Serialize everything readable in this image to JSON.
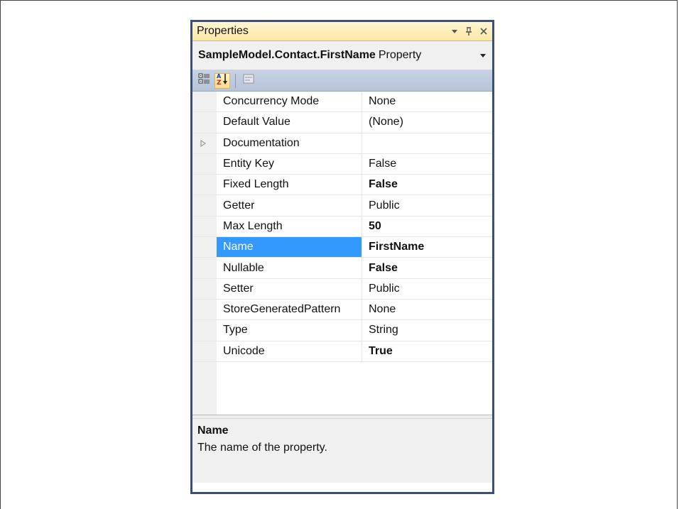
{
  "window": {
    "title": "Properties",
    "selected_object": "SampleModel.Contact.FirstName",
    "selected_object_type": "Property"
  },
  "toolbar": {
    "buttons": [
      {
        "icon": "categorized-icon",
        "active": false
      },
      {
        "icon": "alphabetical-icon",
        "active": true
      },
      {
        "icon": "property-pages-icon",
        "active": false,
        "disabled": true
      }
    ]
  },
  "properties": [
    {
      "name": "Concurrency Mode",
      "value": "None",
      "bold": false
    },
    {
      "name": "Default Value",
      "value": "(None)",
      "bold": false
    },
    {
      "name": "Documentation",
      "value": "",
      "bold": false,
      "expandable": true
    },
    {
      "name": "Entity Key",
      "value": "False",
      "bold": false
    },
    {
      "name": "Fixed Length",
      "value": "False",
      "bold": true
    },
    {
      "name": "Getter",
      "value": "Public",
      "bold": false
    },
    {
      "name": "Max Length",
      "value": "50",
      "bold": true
    },
    {
      "name": "Name",
      "value": "FirstName",
      "bold": true,
      "selected": true
    },
    {
      "name": "Nullable",
      "value": "False",
      "bold": true
    },
    {
      "name": "Setter",
      "value": "Public",
      "bold": false
    },
    {
      "name": "StoreGeneratedPattern",
      "value": "None",
      "bold": false
    },
    {
      "name": "Type",
      "value": "String",
      "bold": false
    },
    {
      "name": "Unicode",
      "value": "True",
      "bold": true
    }
  ],
  "description": {
    "title": "Name",
    "text": "The name of the property."
  },
  "colors": {
    "selection": "#3399ff",
    "titlebar": "#fde7a6",
    "toolbar": "#bcc7da",
    "frame": "#3b4f7a"
  }
}
